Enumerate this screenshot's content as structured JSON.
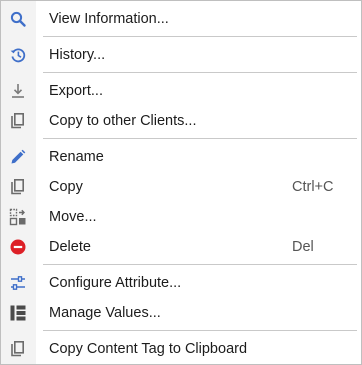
{
  "colors": {
    "icon_blue": "#3f6fc9",
    "icon_gray": "#6b6b6b",
    "delete_red": "#dd1f26",
    "separator": "#c9c9c9",
    "icon_strip": "#f3f3f3"
  },
  "menu": {
    "items": [
      {
        "id": "view-information",
        "label": "View Information...",
        "icon": "search-icon",
        "shortcut": ""
      },
      {
        "id": "history",
        "label": "History...",
        "icon": "history-icon",
        "shortcut": ""
      },
      {
        "id": "export",
        "label": "Export...",
        "icon": "download-icon",
        "shortcut": ""
      },
      {
        "id": "copy-to-other-clients",
        "label": "Copy to other Clients...",
        "icon": "copy-icon",
        "shortcut": ""
      },
      {
        "id": "rename",
        "label": "Rename",
        "icon": "pencil-icon",
        "shortcut": ""
      },
      {
        "id": "copy",
        "label": "Copy",
        "icon": "copy-icon",
        "shortcut": "Ctrl+C"
      },
      {
        "id": "move",
        "label": "Move...",
        "icon": "move-icon",
        "shortcut": ""
      },
      {
        "id": "delete",
        "label": "Delete",
        "icon": "delete-icon",
        "shortcut": "Del"
      },
      {
        "id": "configure-attribute",
        "label": "Configure Attribute...",
        "icon": "sliders-icon",
        "shortcut": ""
      },
      {
        "id": "manage-values",
        "label": "Manage Values...",
        "icon": "list-icon",
        "shortcut": ""
      },
      {
        "id": "copy-content-tag",
        "label": "Copy Content Tag to Clipboard",
        "icon": "copy-icon",
        "shortcut": ""
      }
    ]
  }
}
